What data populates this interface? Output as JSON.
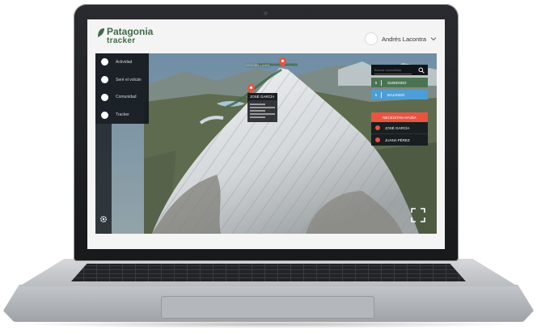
{
  "app": {
    "logo_line1": "Patagonia",
    "logo_line2": "tracker",
    "user_name": "Andrés Lacontra"
  },
  "sidebar": {
    "items": [
      {
        "label": "Actividad"
      },
      {
        "label": "Seré el volcán"
      },
      {
        "label": "Comunidad"
      },
      {
        "label": "Tracker"
      }
    ]
  },
  "map": {
    "summit_label": "VOLCÁN LANÍN",
    "popup": {
      "name": "JOSÉ GARCÍA"
    }
  },
  "panel": {
    "search_placeholder": "Buscar montañista",
    "up": {
      "count": "8",
      "label": "SUBIENDO"
    },
    "down": {
      "count": "5",
      "label": "BAJANDO"
    },
    "help_title": "NECESITAN AYUDA",
    "help_people": [
      {
        "name": "JOSÉ GARCÍA"
      },
      {
        "name": "JUANA PÉREZ"
      }
    ]
  },
  "colors": {
    "brand_green": "#3f6a49",
    "subiendo_green": "#4b7352",
    "bajando_blue": "#4d9ed6",
    "alert_red": "#e9543f"
  },
  "icons": [
    "leaf-logo-icon",
    "chevron-down-icon",
    "search-icon",
    "gear-icon",
    "fullscreen-icon",
    "map-pin-icon"
  ]
}
